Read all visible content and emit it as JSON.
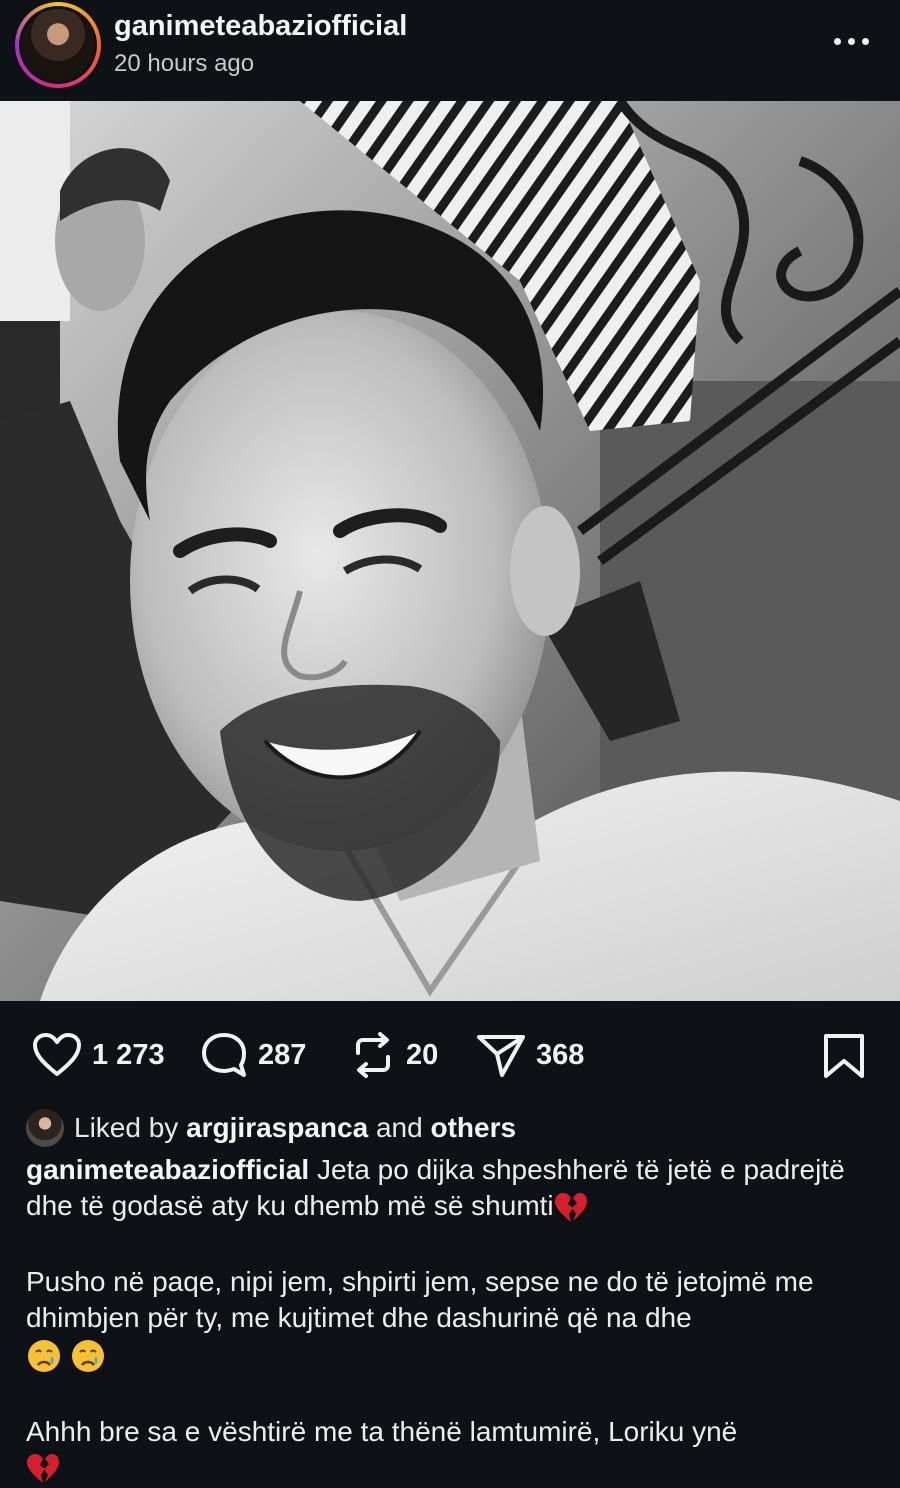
{
  "post": {
    "username": "ganimeteabaziofficial",
    "time_ago": "20 hours ago",
    "image_description_icon": "portrait-photo"
  },
  "actions": {
    "likes": "1 273",
    "comments": "287",
    "reposts": "20",
    "shares": "368"
  },
  "liked_by": {
    "prefix": "Liked by",
    "user": "argjiraspanca",
    "connector": "and",
    "others": "others"
  },
  "caption": {
    "author": "ganimeteabaziofficial",
    "line1": "Jeta po dijka shpeshherë të jetë e padrejtë dhe të godasë aty ku dhemb më së shumti",
    "line2": "Pusho në paqe, nipi jem, shpirti jem, sepse ne do të jetojmë me dhimbjen për ty, me kujtimet dhe dashurinë që na dhe",
    "line3": "Ahhh bre sa e vështirë me ta thënë lamtumirë, Loriku ynë"
  },
  "colors": {
    "background": "#0e1217",
    "text": "#f2f2f2",
    "broken_heart": "#d4202c",
    "crying_face": "#f6c134"
  }
}
